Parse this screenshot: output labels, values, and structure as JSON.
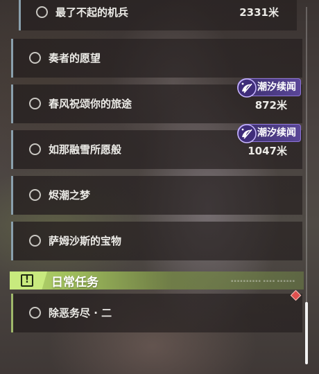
{
  "quests": [
    {
      "name": "最了不起的机兵",
      "distance": "2331米"
    },
    {
      "name": "奏者的愿望"
    },
    {
      "name": "春风祝颂你的旅途",
      "badge": "潮汐续闻",
      "distance": "872米"
    },
    {
      "name": "如那融雪所愿般",
      "badge": "潮汐续闻",
      "distance": "1047米"
    },
    {
      "name": "烬潮之梦"
    },
    {
      "name": "萨姆沙斯的宝物"
    }
  ],
  "daily": {
    "header_icon": "!",
    "title": "日常任务",
    "quests": [
      {
        "name": "除恶务尽 · 二"
      }
    ]
  },
  "colors": {
    "badge": "#5a4698",
    "daily_accent": "#b9db74",
    "quest_border": "#8aa0ad",
    "marker": "#e0504f"
  },
  "icons": {
    "status": "circle-icon",
    "badge": "tide-swirl-icon",
    "daily": "exclamation-icon",
    "tracked": "diamond-marker-icon"
  }
}
